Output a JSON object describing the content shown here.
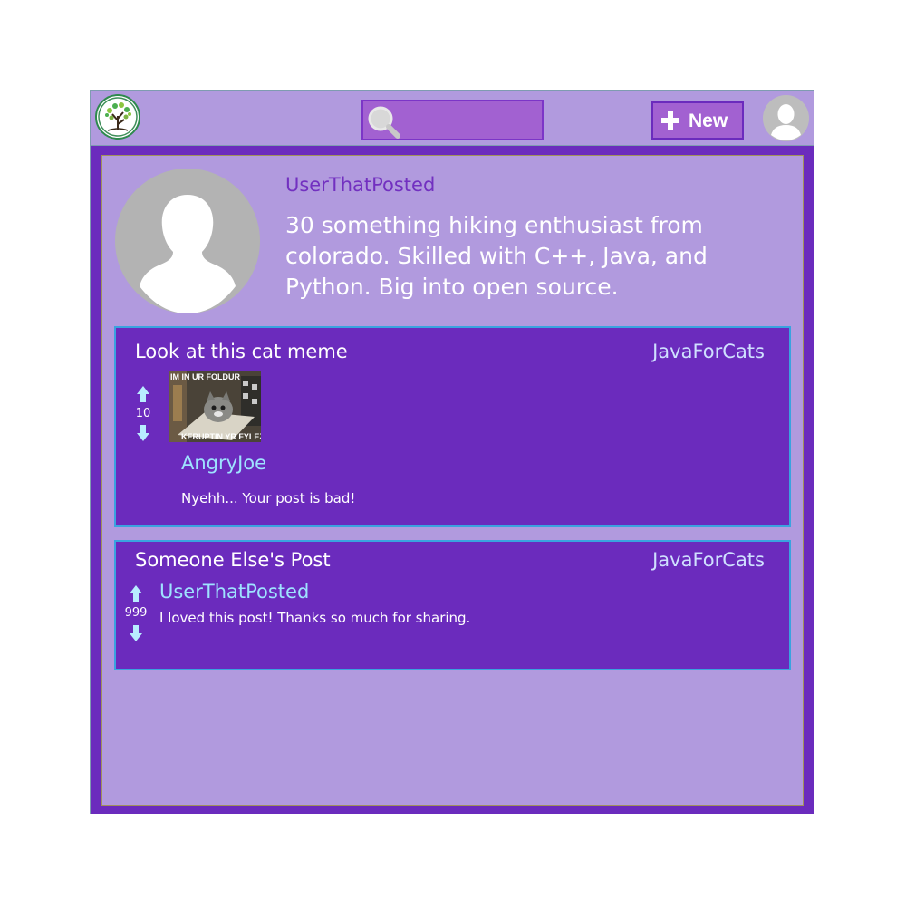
{
  "header": {
    "logo_icon": "tree-logo-icon",
    "search": {
      "icon": "search-icon",
      "placeholder": ""
    },
    "new_button": {
      "icon": "plus-icon",
      "label": "New"
    },
    "avatar_icon": "user-avatar-icon"
  },
  "profile": {
    "avatar_icon": "user-silhouette-icon",
    "username": "UserThatPosted",
    "bio": "30 something hiking enthusiast from colorado. Skilled with C++, Java, and Python. Big into open source."
  },
  "posts": [
    {
      "title": "Look at this cat meme",
      "community": "JavaForCats",
      "votes": "10",
      "image": {
        "top_caption": "IM IN UR FOLDUR",
        "bottom_caption": "KERUPTIN YR FYLEZ"
      },
      "comment": {
        "author": "AngryJoe",
        "text": "Nyehh... Your post is bad!"
      }
    },
    {
      "title": "Someone Else's Post",
      "community": "JavaForCats",
      "votes": "999",
      "comment": {
        "author": "UserThatPosted",
        "text": "I loved this post! Thanks so much for sharing."
      }
    }
  ],
  "colors": {
    "frame": "#6b2bbd",
    "panel": "#b19ade",
    "accent_link": "#9ee3ff",
    "post_border": "#3aa3df"
  }
}
